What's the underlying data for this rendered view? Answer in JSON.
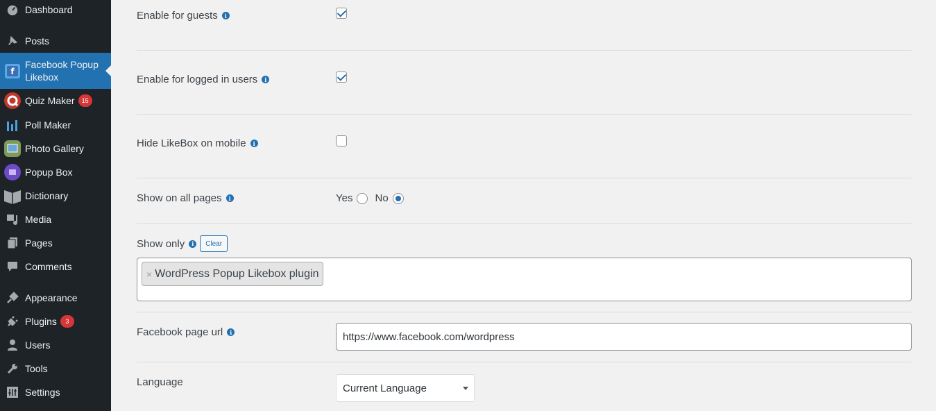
{
  "sidebar": {
    "items": [
      {
        "label": "Dashboard",
        "icon": "dashboard-icon"
      },
      {
        "label": "Posts",
        "icon": "pin-icon"
      },
      {
        "label": "Facebook Popup Likebox",
        "icon": "facebook-cube-icon"
      },
      {
        "label": "Quiz Maker",
        "icon": "quiz-icon",
        "badge": "15"
      },
      {
        "label": "Poll Maker",
        "icon": "poll-bars-icon"
      },
      {
        "label": "Photo Gallery",
        "icon": "gallery-icon"
      },
      {
        "label": "Popup Box",
        "icon": "popup-icon"
      },
      {
        "label": "Dictionary",
        "icon": "book-icon"
      },
      {
        "label": "Media",
        "icon": "media-icon"
      },
      {
        "label": "Pages",
        "icon": "pages-icon"
      },
      {
        "label": "Comments",
        "icon": "comment-icon"
      },
      {
        "label": "Appearance",
        "icon": "brush-icon"
      },
      {
        "label": "Plugins",
        "icon": "plugin-icon",
        "badge": "3"
      },
      {
        "label": "Users",
        "icon": "user-icon"
      },
      {
        "label": "Tools",
        "icon": "wrench-icon"
      },
      {
        "label": "Settings",
        "icon": "settings-sliders-icon"
      }
    ]
  },
  "settings": {
    "enable_guests": {
      "label": "Enable for guests",
      "checked": true
    },
    "enable_logged_in": {
      "label": "Enable for logged in users",
      "checked": true
    },
    "hide_mobile": {
      "label": "Hide LikeBox on mobile",
      "checked": false
    },
    "show_all_pages": {
      "label": "Show on all pages",
      "yes": "Yes",
      "no": "No",
      "selected": "No"
    },
    "show_only": {
      "label": "Show only",
      "clear": "Clear",
      "tags": [
        "WordPress Popup Likebox plugin"
      ],
      "remove": "×"
    },
    "page_url": {
      "label": "Facebook page url",
      "value": "https://www.facebook.com/wordpress"
    },
    "language": {
      "label": "Language",
      "value": "Current Language"
    }
  },
  "colors": {
    "sidebar_bg": "#1d2327",
    "accent": "#2271b1",
    "badge": "#d63638"
  }
}
